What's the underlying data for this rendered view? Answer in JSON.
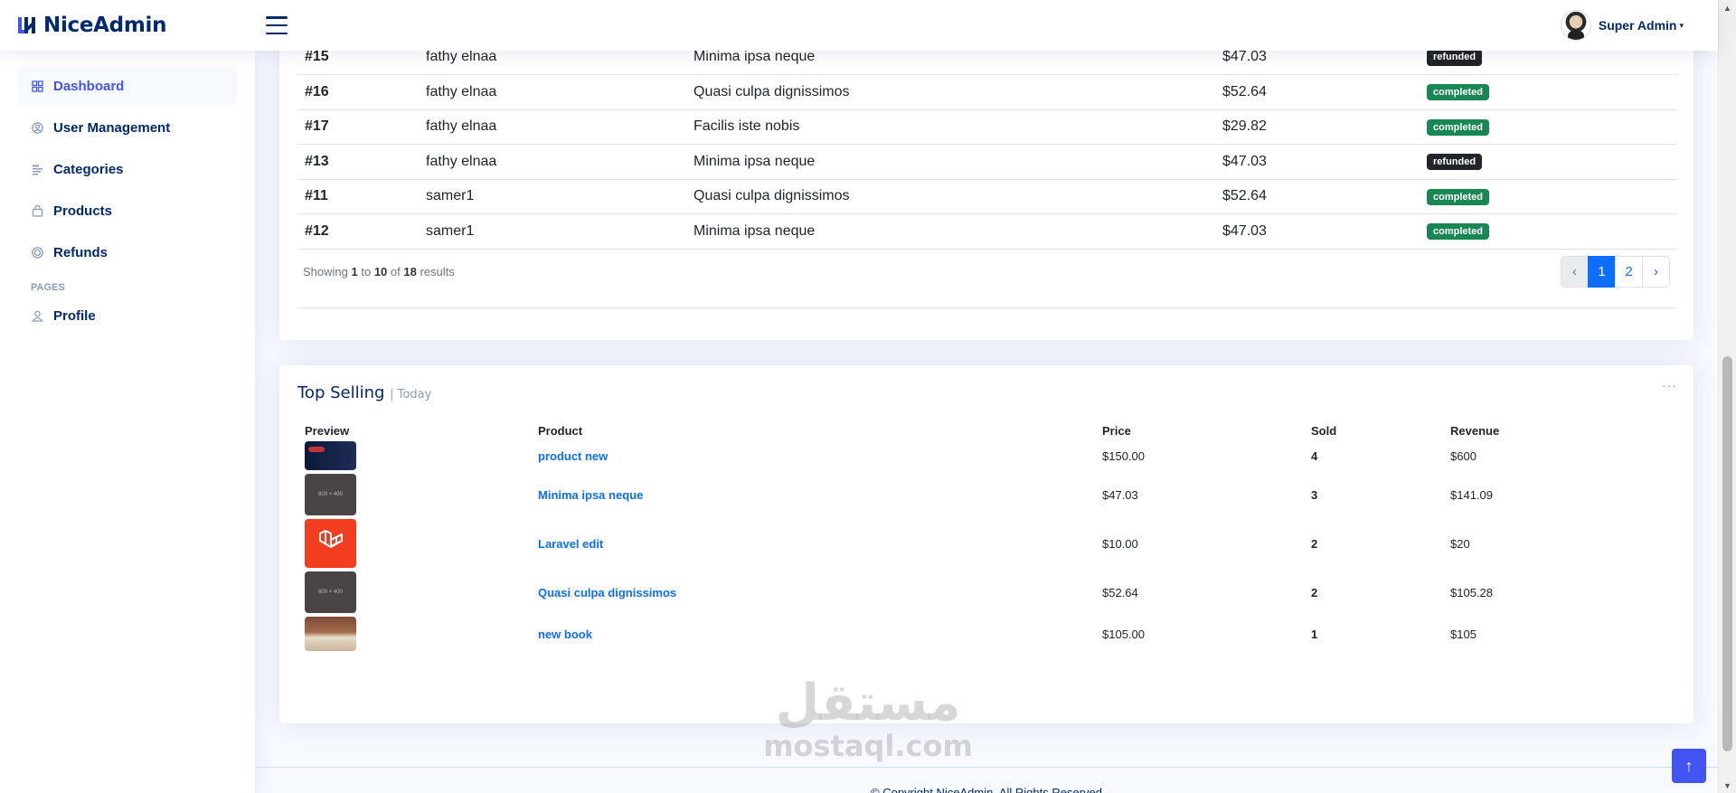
{
  "app": {
    "name": "NiceAdmin"
  },
  "header": {
    "user_name": "Super Admin"
  },
  "sidebar": {
    "items": [
      {
        "label": "Dashboard",
        "icon": "grid-icon",
        "active": true
      },
      {
        "label": "User Management",
        "icon": "person-circle-icon"
      },
      {
        "label": "Categories",
        "icon": "layout-text-icon"
      },
      {
        "label": "Products",
        "icon": "bag-icon"
      },
      {
        "label": "Refunds",
        "icon": "coin-icon"
      }
    ],
    "pages_heading": "PAGES",
    "pages": [
      {
        "label": "Profile",
        "icon": "person-icon"
      }
    ]
  },
  "recent_orders": {
    "rows": [
      {
        "id": "#15",
        "customer": "fathy elnaa",
        "product": "Minima ipsa neque",
        "price": "$47.03",
        "status": "refunded"
      },
      {
        "id": "#16",
        "customer": "fathy elnaa",
        "product": "Quasi culpa dignissimos",
        "price": "$52.64",
        "status": "completed"
      },
      {
        "id": "#17",
        "customer": "fathy elnaa",
        "product": "Facilis iste nobis",
        "price": "$29.82",
        "status": "completed"
      },
      {
        "id": "#13",
        "customer": "fathy elnaa",
        "product": "Minima ipsa neque",
        "price": "$47.03",
        "status": "refunded"
      },
      {
        "id": "#11",
        "customer": "samer1",
        "product": "Quasi culpa dignissimos",
        "price": "$52.64",
        "status": "completed"
      },
      {
        "id": "#12",
        "customer": "samer1",
        "product": "Minima ipsa neque",
        "price": "$47.03",
        "status": "completed"
      }
    ],
    "showing": {
      "prefix": "Showing",
      "from": "1",
      "to_word": "to",
      "to": "10",
      "of_word": "of",
      "total": "18",
      "suffix": "results"
    },
    "pagination": {
      "prev": "‹",
      "pages": [
        "1",
        "2"
      ],
      "current": "1",
      "next": "›"
    }
  },
  "top_selling": {
    "title": "Top Selling",
    "subtitle": "| Today",
    "menu": "···",
    "columns": [
      "Preview",
      "Product",
      "Price",
      "Sold",
      "Revenue"
    ],
    "rows": [
      {
        "thumb": "dark",
        "product": "product new",
        "price": "$150.00",
        "sold": "4",
        "revenue": "$600"
      },
      {
        "thumb": "grey",
        "thumb_text": "600 × 400",
        "product": "Minima ipsa neque",
        "price": "$47.03",
        "sold": "3",
        "revenue": "$141.09"
      },
      {
        "thumb": "laravel",
        "product": "Laravel edit",
        "price": "$10.00",
        "sold": "2",
        "revenue": "$20"
      },
      {
        "thumb": "grey",
        "thumb_text": "600 × 400",
        "product": "Quasi culpa dignissimos",
        "price": "$52.64",
        "sold": "2",
        "revenue": "$105.28"
      },
      {
        "thumb": "book",
        "product": "new book",
        "price": "$105.00",
        "sold": "1",
        "revenue": "$105"
      }
    ]
  },
  "footer": {
    "text": "© Copyright NiceAdmin. All Rights Reserved"
  },
  "watermark": {
    "arabic": "مستقل",
    "latin": "mostaql.com"
  },
  "colors": {
    "primary": "#4154f1",
    "navy": "#012970",
    "link": "#0d6efd",
    "success": "#198754",
    "dark": "#212529"
  }
}
